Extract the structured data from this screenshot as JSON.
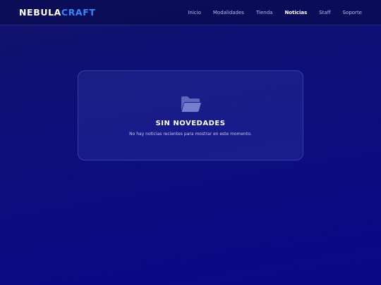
{
  "header": {
    "logo": {
      "part_a": "NEBULA",
      "part_b": "CRAFT"
    },
    "nav": [
      {
        "label": "Inicio",
        "active": false
      },
      {
        "label": "Modalidades",
        "active": false
      },
      {
        "label": "Tienda",
        "active": false
      },
      {
        "label": "Noticias",
        "active": true
      },
      {
        "label": "Staff",
        "active": false
      },
      {
        "label": "Soporte",
        "active": false
      }
    ]
  },
  "empty_state": {
    "icon": "folder-open-icon",
    "title": "SIN NOVEDADES",
    "message": "No hay noticias recientes para mostrar en este momento."
  },
  "colors": {
    "background": "#0d0f78",
    "accent": "#2f8bff",
    "nav_text": "#b9bfe8"
  }
}
